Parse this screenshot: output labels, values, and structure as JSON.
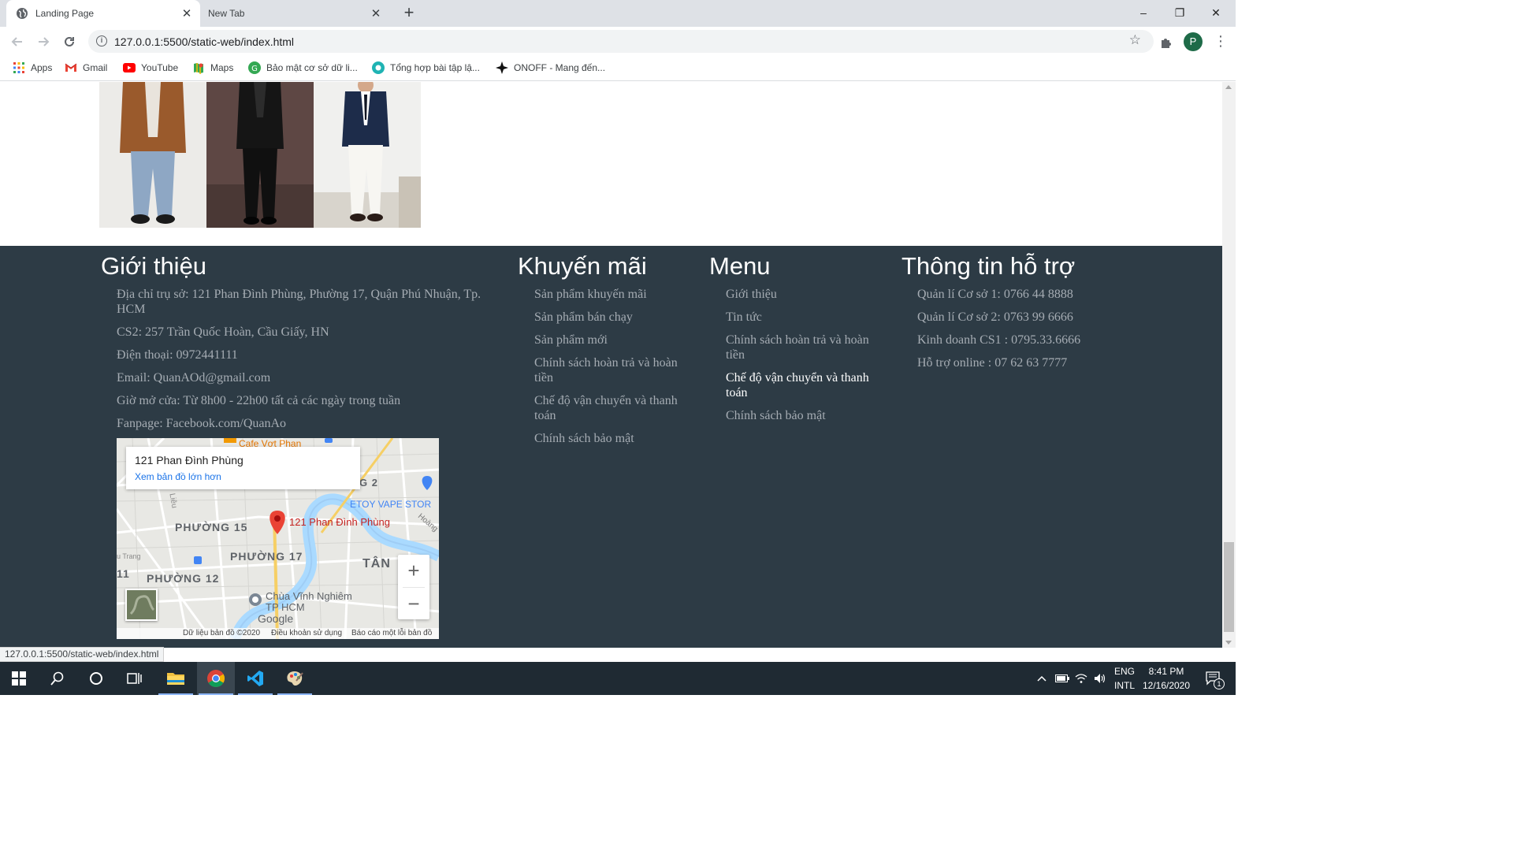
{
  "browser": {
    "tabs": [
      {
        "title": "Landing Page",
        "active": true
      },
      {
        "title": "New Tab",
        "active": false
      }
    ],
    "new_tab_symbol": "+",
    "window_controls": {
      "minimize": "–",
      "restore": "❐",
      "close": "✕"
    },
    "url": "127.0.0.1:5500/static-web/index.html",
    "profile_initial": "P",
    "bookmarks": [
      {
        "label": "Apps",
        "icon": "apps-grid-icon"
      },
      {
        "label": "Gmail",
        "icon": "gmail-icon"
      },
      {
        "label": "YouTube",
        "icon": "youtube-icon"
      },
      {
        "label": "Maps",
        "icon": "maps-icon"
      },
      {
        "label": "Bảo mật cơ sở dữ li...",
        "icon": "green-g-icon"
      },
      {
        "label": "Tổng hợp bài tập lậ...",
        "icon": "teal-logo-icon"
      },
      {
        "label": "ONOFF - Mang đến...",
        "icon": "onoff-icon"
      }
    ],
    "status_url": "127.0.0.1:5500/static-web/index.html"
  },
  "footer": {
    "about": {
      "title": "Giới thiệu",
      "items": [
        "Địa chỉ trụ sở: 121 Phan Đình Phùng, Phường 17, Quận Phú Nhuận, Tp. HCM",
        "CS2: 257 Trần Quốc Hoàn, Cầu Giấy, HN",
        "Điện thoại: 0972441111",
        "Email: QuanAOd@gmail.com",
        "Giờ mở cửa: Từ 8h00 - 22h00 tất cả các ngày trong tuần",
        "Fanpage: Facebook.com/QuanAo"
      ]
    },
    "promotions": {
      "title": "Khuyến mãi",
      "items": [
        "Sản phẩm khuyến mãi",
        "Sản phẩm bán chạy",
        "Sản phẩm mới",
        "Chính sách hoàn trả và hoàn tiền",
        "Chế độ vận chuyển và thanh toán",
        "Chính sách bảo mật"
      ]
    },
    "menu": {
      "title": "Menu",
      "items": [
        "Giới thiệu",
        "Tin tức",
        "Chính sách hoàn trả và hoàn tiền",
        "Chế độ vận chuyển và thanh toán",
        "Chính sách bảo mật"
      ],
      "hovered_index": 3
    },
    "support": {
      "title": "Thông tin hỗ trợ",
      "items": [
        "Quản lí Cơ sở 1: 0766 44 8888",
        "Quản lí Cơ sở 2: 0763 99 6666",
        "Kinh doanh CS1 : 0795.33.6666",
        "Hỗ trợ online : 07 62 63 7777"
      ]
    }
  },
  "map": {
    "place_name": "121 Phan Đình Phùng",
    "larger_map_link": "Xem bản đồ lớn hơn",
    "pin_label": "121 Phan Đình Phùng",
    "top_poi": "Cafe Vợt Phan",
    "labels": [
      "PHƯỜNG 15",
      "PHƯỜNG 17",
      "PHƯỜNG 12",
      "TÂN",
      "G 2",
      "11"
    ],
    "etoy": "ETOY VAPE STOR",
    "hoang": "Hoàng",
    "pagoda": "Chùa Vĩnh Nghiêm TP HCM",
    "google": "Google",
    "zoom_in": "+",
    "zoom_out": "−",
    "footer_data": "Dữ liệu bản đồ ©2020",
    "footer_terms": "Điều khoản sử dụng",
    "footer_report": "Báo cáo một lỗi bản đồ",
    "side_street": "Liêu",
    "side_street2": "u Trang"
  },
  "taskbar": {
    "language": "ENG",
    "layout": "INTL",
    "time": "8:41 PM",
    "date": "12/16/2020",
    "notification_count": "1"
  },
  "colors": {
    "footer_bg": "#2d3b45",
    "footer_text": "#a5acb3",
    "footer_heading": "#ffffff",
    "taskbar_bg": "#1f2a33"
  }
}
